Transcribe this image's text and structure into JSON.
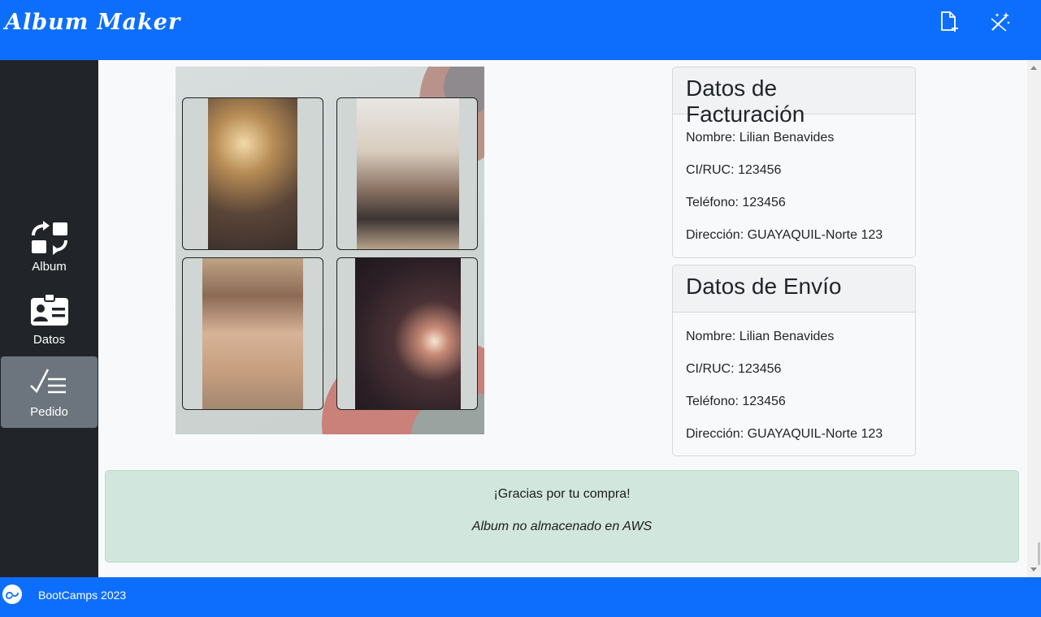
{
  "header": {
    "title": "Album Maker",
    "icons": [
      "new-file-icon",
      "magic-wand-icon"
    ]
  },
  "sidebar": {
    "items": [
      {
        "label": "Album",
        "icon": "swap-icon",
        "active": false
      },
      {
        "label": "Datos",
        "icon": "id-card-icon",
        "active": false
      },
      {
        "label": "Pedido",
        "icon": "checklist-icon",
        "active": true
      }
    ]
  },
  "album": {
    "photos": [
      "champagne-toast-photo",
      "couple-photo",
      "woman-hat-photo",
      "birthday-cake-photo"
    ]
  },
  "billing": {
    "title": "Datos de Facturación",
    "nombre": "Nombre: Lilian Benavides",
    "ciruc": "CI/RUC: 123456",
    "telefono": "Teléfono: 123456",
    "direccion": "Dirección: GUAYAQUIL-Norte 123"
  },
  "shipping": {
    "title": "Datos de Envío",
    "nombre": "Nombre: Lilian Benavides",
    "ciruc": "CI/RUC: 123456",
    "telefono": "Teléfono: 123456",
    "direccion": "Dirección: GUAYAQUIL-Norte 123"
  },
  "alert": {
    "message": "¡Gracias por tu compra!",
    "note": "Album no almacenado en AWS"
  },
  "footer": {
    "text": "BootCamps 2023"
  },
  "colors": {
    "primary": "#0d6efd",
    "sidebar": "#212529",
    "active": "#6c757d",
    "success_bg": "#d1e7dd"
  }
}
